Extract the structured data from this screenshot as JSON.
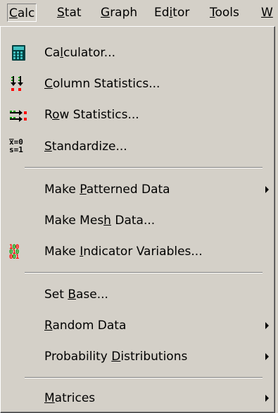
{
  "menubar": {
    "calc": {
      "u": "C",
      "rest": "alc"
    },
    "stat": {
      "u": "S",
      "rest": "tat"
    },
    "graph": {
      "u": "G",
      "rest": "raph"
    },
    "editor": {
      "pre": "Ed",
      "u": "i",
      "rest": "tor"
    },
    "tools": {
      "u": "T",
      "rest": "ools"
    },
    "window": {
      "u": "W",
      "rest": ""
    }
  },
  "menu": {
    "calculator": {
      "pre": "Ca",
      "u": "l",
      "rest": "culator..."
    },
    "column_statistics": {
      "pre": "",
      "u": "C",
      "rest": "olumn Statistics..."
    },
    "row_statistics": {
      "pre": "R",
      "u": "o",
      "rest": "w Statistics..."
    },
    "standardize": {
      "pre": "",
      "u": "S",
      "rest": "tandardize..."
    },
    "make_patterned_data": {
      "pre": "Make ",
      "u": "P",
      "rest": "atterned Data"
    },
    "make_mesh_data": {
      "pre": "Make Mes",
      "u": "h",
      "rest": " Data..."
    },
    "make_indicator_variables": {
      "pre": "Make ",
      "u": "I",
      "rest": "ndicator Variables..."
    },
    "set_base": {
      "pre": "Set ",
      "u": "B",
      "rest": "ase..."
    },
    "random_data": {
      "pre": "",
      "u": "R",
      "rest": "andom Data"
    },
    "probability_distributions": {
      "pre": "Probability ",
      "u": "D",
      "rest": "istributions"
    },
    "matrices": {
      "pre": "",
      "u": "M",
      "rest": "atrices"
    }
  },
  "icons": {
    "standardize_line1": "x̅=0",
    "standardize_line2": "s=1"
  },
  "colors": {
    "menu_bg": "#d4d0c8",
    "icon_red": "#ff0000",
    "icon_green": "#00a000",
    "calculator_body": "#004040",
    "calculator_display": "#40c0c0"
  }
}
